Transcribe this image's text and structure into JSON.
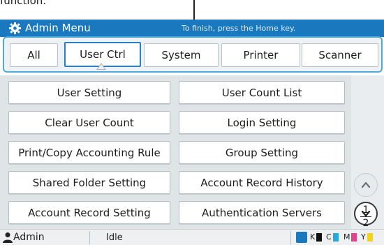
{
  "caption": "function.",
  "title": {
    "label": "Admin Menu",
    "hint": "To finish, press the Home key."
  },
  "tabs": [
    {
      "label": "All"
    },
    {
      "label": "User Ctrl"
    },
    {
      "label": "System"
    },
    {
      "label": "Printer"
    },
    {
      "label": "Scanner"
    }
  ],
  "active_tab": "User Ctrl",
  "menu": {
    "left": [
      "User Setting",
      "Clear User Count",
      "Print/Copy Accounting Rule",
      "Shared Folder Setting",
      "Account Record Setting"
    ],
    "right": [
      "User Count List",
      "Login Setting",
      "Group Setting",
      "Account Record History",
      "Authentication Servers"
    ]
  },
  "pagination": {
    "current": "1",
    "total": "2"
  },
  "status": {
    "user": "Admin",
    "state": "Idle",
    "inks": [
      {
        "label": "K",
        "color": "#111111"
      },
      {
        "label": "C",
        "color": "#29a7e1"
      },
      {
        "label": "M",
        "color": "#e0428f"
      },
      {
        "label": "Y",
        "color": "#f2d21b"
      }
    ]
  },
  "icons": {
    "title": "gear-icon",
    "scroll_up": "chevron-up-icon",
    "scroll_down": "chevron-down-icon",
    "user": "user-icon",
    "ink": "ink-icon"
  }
}
